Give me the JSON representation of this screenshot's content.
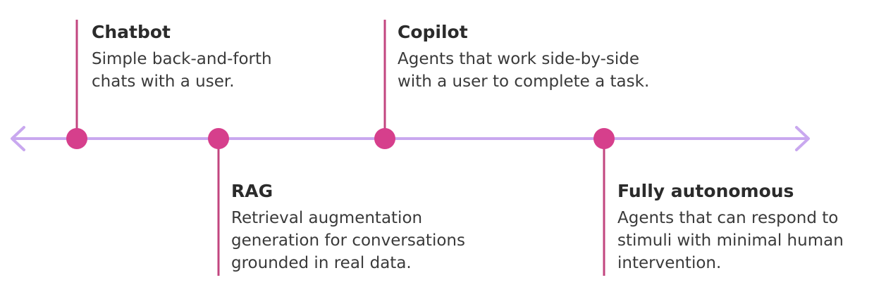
{
  "colors": {
    "axis": "#c9a8ef",
    "marker": "#d63f8c",
    "connector": "#c2457f"
  },
  "stages": [
    {
      "title": "Chatbot",
      "desc_lines": [
        "Simple back-and-forth",
        "chats with a user."
      ],
      "position": "above"
    },
    {
      "title": "RAG",
      "desc_lines": [
        "Retrieval augmentation",
        "generation for conversations",
        "grounded in real data."
      ],
      "position": "below"
    },
    {
      "title": "Copilot",
      "desc_lines": [
        "Agents that work side-by-side",
        "with a user to complete a task."
      ],
      "position": "above"
    },
    {
      "title": "Fully autonomous",
      "desc_lines": [
        "Agents that can respond to",
        "stimuli with minimal human",
        "intervention."
      ],
      "position": "below"
    }
  ]
}
